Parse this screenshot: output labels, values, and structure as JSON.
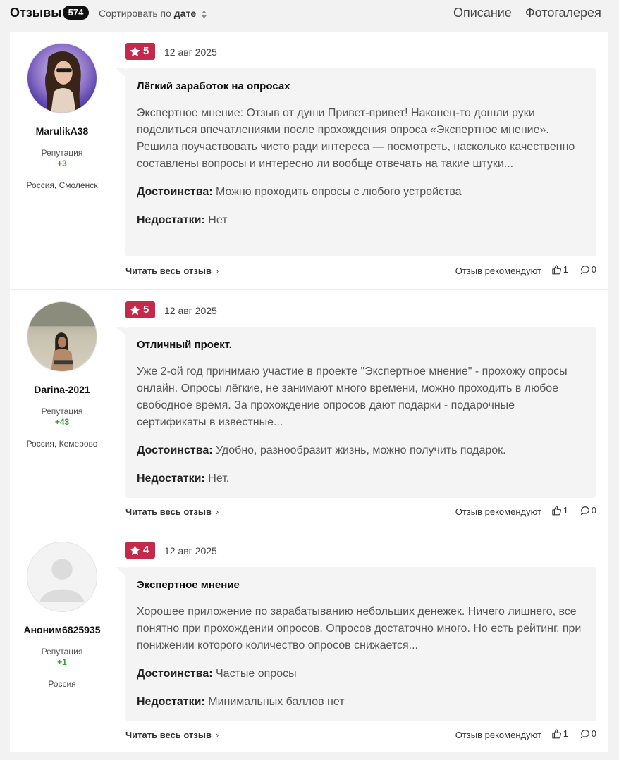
{
  "header": {
    "title": "Отзывы",
    "count": "574",
    "sort_prefix": "Сортировать по",
    "sort_value": "дате",
    "links": [
      "Описание",
      "Фотогалерея"
    ]
  },
  "labels": {
    "reputation": "Репутация",
    "read_more": "Читать весь отзыв",
    "recommend": "Отзыв рекомендуют",
    "pros": "Достоинства:",
    "cons": "Недостатки:"
  },
  "colors": {
    "rating_badge": "#c4284a",
    "reputation_value": "#2e9e3e"
  },
  "reviews": [
    {
      "author": "MarulikA38",
      "reputation": "+3",
      "location": "Россия, Смоленск",
      "rating": "5",
      "date": "12 авг 2025",
      "title": "Лёгкий заработок на опросах",
      "text": "Экспертное мнение: Отзыв от души Привет-привет! Наконец-то дошли руки поделиться впечатлениями после прохождения опроса «Экспертное мнение». Решила поучаствовать чисто ради интереса — посмотреть, насколько качественно составлены вопросы и интересно ли вообще отвечать на такие штуки...",
      "pros": "Можно проходить опросы с любого устройства",
      "cons": "Нет",
      "likes": "1",
      "comments": "0"
    },
    {
      "author": "Darina-2021",
      "reputation": "+43",
      "location": "Россия, Кемерово",
      "rating": "5",
      "date": "12 авг 2025",
      "title": "Отличный проект.",
      "text": "Уже 2-ой год принимаю участие в проекте \"Экспертное мнение\" - прохожу опросы онлайн. Опросы лёгкие, не занимают много времени, можно проходить в любое свободное время. За прохождение опросов дают подарки - подарочные сертификаты в известные...",
      "pros": "Удобно, разнообразит жизнь, можно получить подарок.",
      "cons": "Нет.",
      "likes": "1",
      "comments": "0"
    },
    {
      "author": "Аноним6825935",
      "reputation": "+1",
      "location": "Россия",
      "rating": "4",
      "date": "12 авг 2025",
      "title": "Экспертное мнение",
      "text": "Хорошее приложение по зарабатыванию небольших денежек. Ничего лишнего, все понятно при прохождении опросов. Опросов достаточно много. Но есть рейтинг, при понижении которого количество опросов снижается...",
      "pros": "Частые опросы",
      "cons": "Минимальных баллов нет",
      "likes": "1",
      "comments": "0"
    }
  ]
}
